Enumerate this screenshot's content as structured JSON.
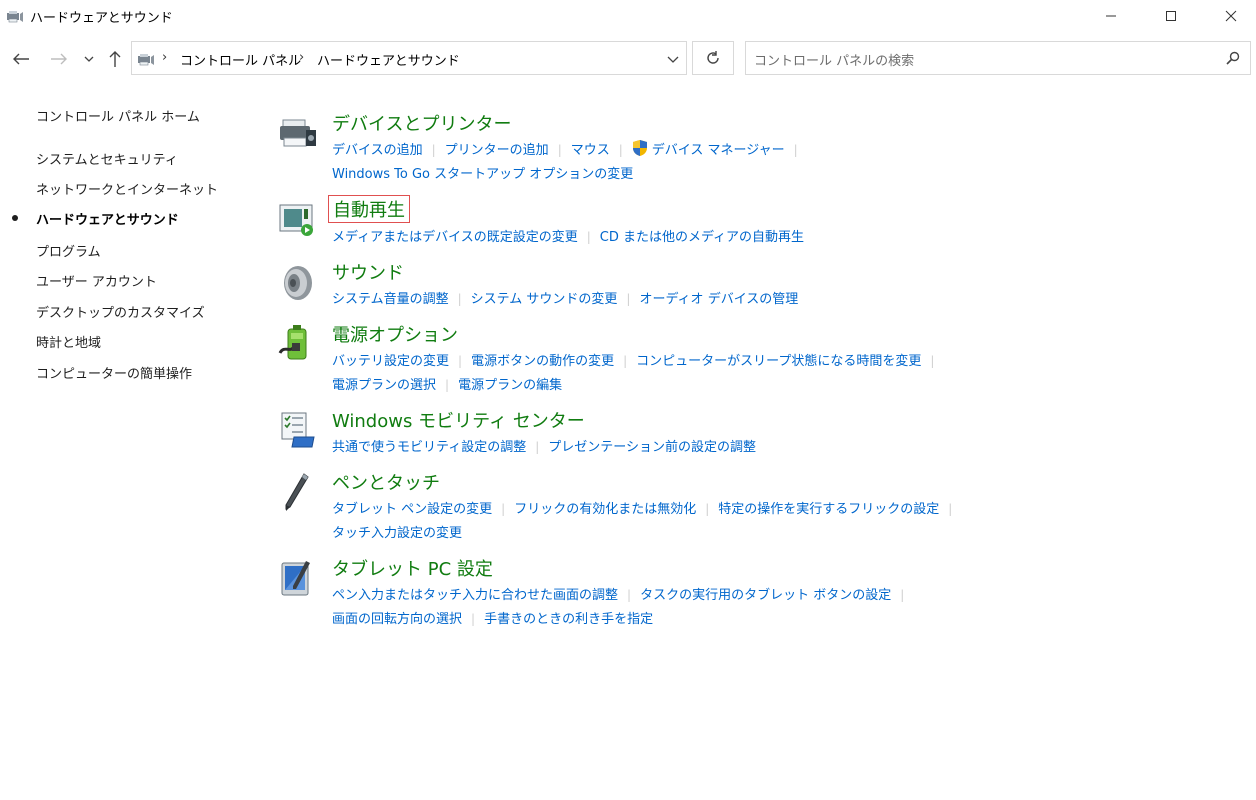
{
  "window": {
    "title": "ハードウェアとサウンド",
    "icon": "hardware-sound-icon"
  },
  "address": {
    "crumbs": [
      "コントロール パネル",
      "ハードウェアとサウンド"
    ],
    "search_placeholder": "コントロール パネルの検索"
  },
  "sidebar": {
    "home": "コントロール パネル ホーム",
    "items": [
      {
        "label": "システムとセキュリティ"
      },
      {
        "label": "ネットワークとインターネット"
      },
      {
        "label": "ハードウェアとサウンド",
        "active": true
      },
      {
        "label": "プログラム"
      },
      {
        "label": "ユーザー アカウント"
      },
      {
        "label": "デスクトップのカスタマイズ"
      },
      {
        "label": "時計と地域"
      },
      {
        "label": "コンピューターの簡単操作"
      }
    ]
  },
  "categories": [
    {
      "title": "デバイスとプリンター",
      "icon": "printer-icon",
      "lines": [
        [
          "デバイスの追加",
          "プリンターの追加",
          "マウス",
          "デバイス マネージャー"
        ],
        [
          "Windows To Go スタートアップ オプションの変更"
        ]
      ]
    },
    {
      "title": "自動再生",
      "icon": "autoplay-icon",
      "lines": [
        [
          "メディアまたはデバイスの既定設定の変更",
          "CD または他のメディアの自動再生"
        ]
      ]
    },
    {
      "title": "サウンド",
      "icon": "speaker-icon",
      "lines": [
        [
          "システム音量の調整",
          "システム サウンドの変更",
          "オーディオ デバイスの管理"
        ]
      ]
    },
    {
      "title": "電源オプション",
      "icon": "battery-plug-icon",
      "lines": [
        [
          "バッテリ設定の変更",
          "電源ボタンの動作の変更",
          "コンピューターがスリープ状態になる時間を変更"
        ],
        [
          "電源プランの選択",
          "電源プランの編集"
        ]
      ]
    },
    {
      "title": "Windows モビリティ センター",
      "icon": "mobility-center-icon",
      "lines": [
        [
          "共通で使うモビリティ設定の調整",
          "プレゼンテーション前の設定の調整"
        ]
      ]
    },
    {
      "title": "ペンとタッチ",
      "icon": "pen-icon",
      "lines": [
        [
          "タブレット ペン設定の変更",
          "フリックの有効化または無効化",
          "特定の操作を実行するフリックの設定"
        ],
        [
          "タッチ入力設定の変更"
        ]
      ]
    },
    {
      "title": "タブレット PC 設定",
      "icon": "tablet-pc-icon",
      "lines": [
        [
          "ペン入力またはタッチ入力に合わせた画面の調整",
          "タスクの実行用のタブレット ボタンの設定"
        ],
        [
          "画面の回転方向の選択",
          "手書きのときの利き手を指定"
        ]
      ]
    }
  ],
  "colors": {
    "category_title": "#107c10",
    "link": "#0066cc",
    "highlight_box": "#e05050"
  }
}
